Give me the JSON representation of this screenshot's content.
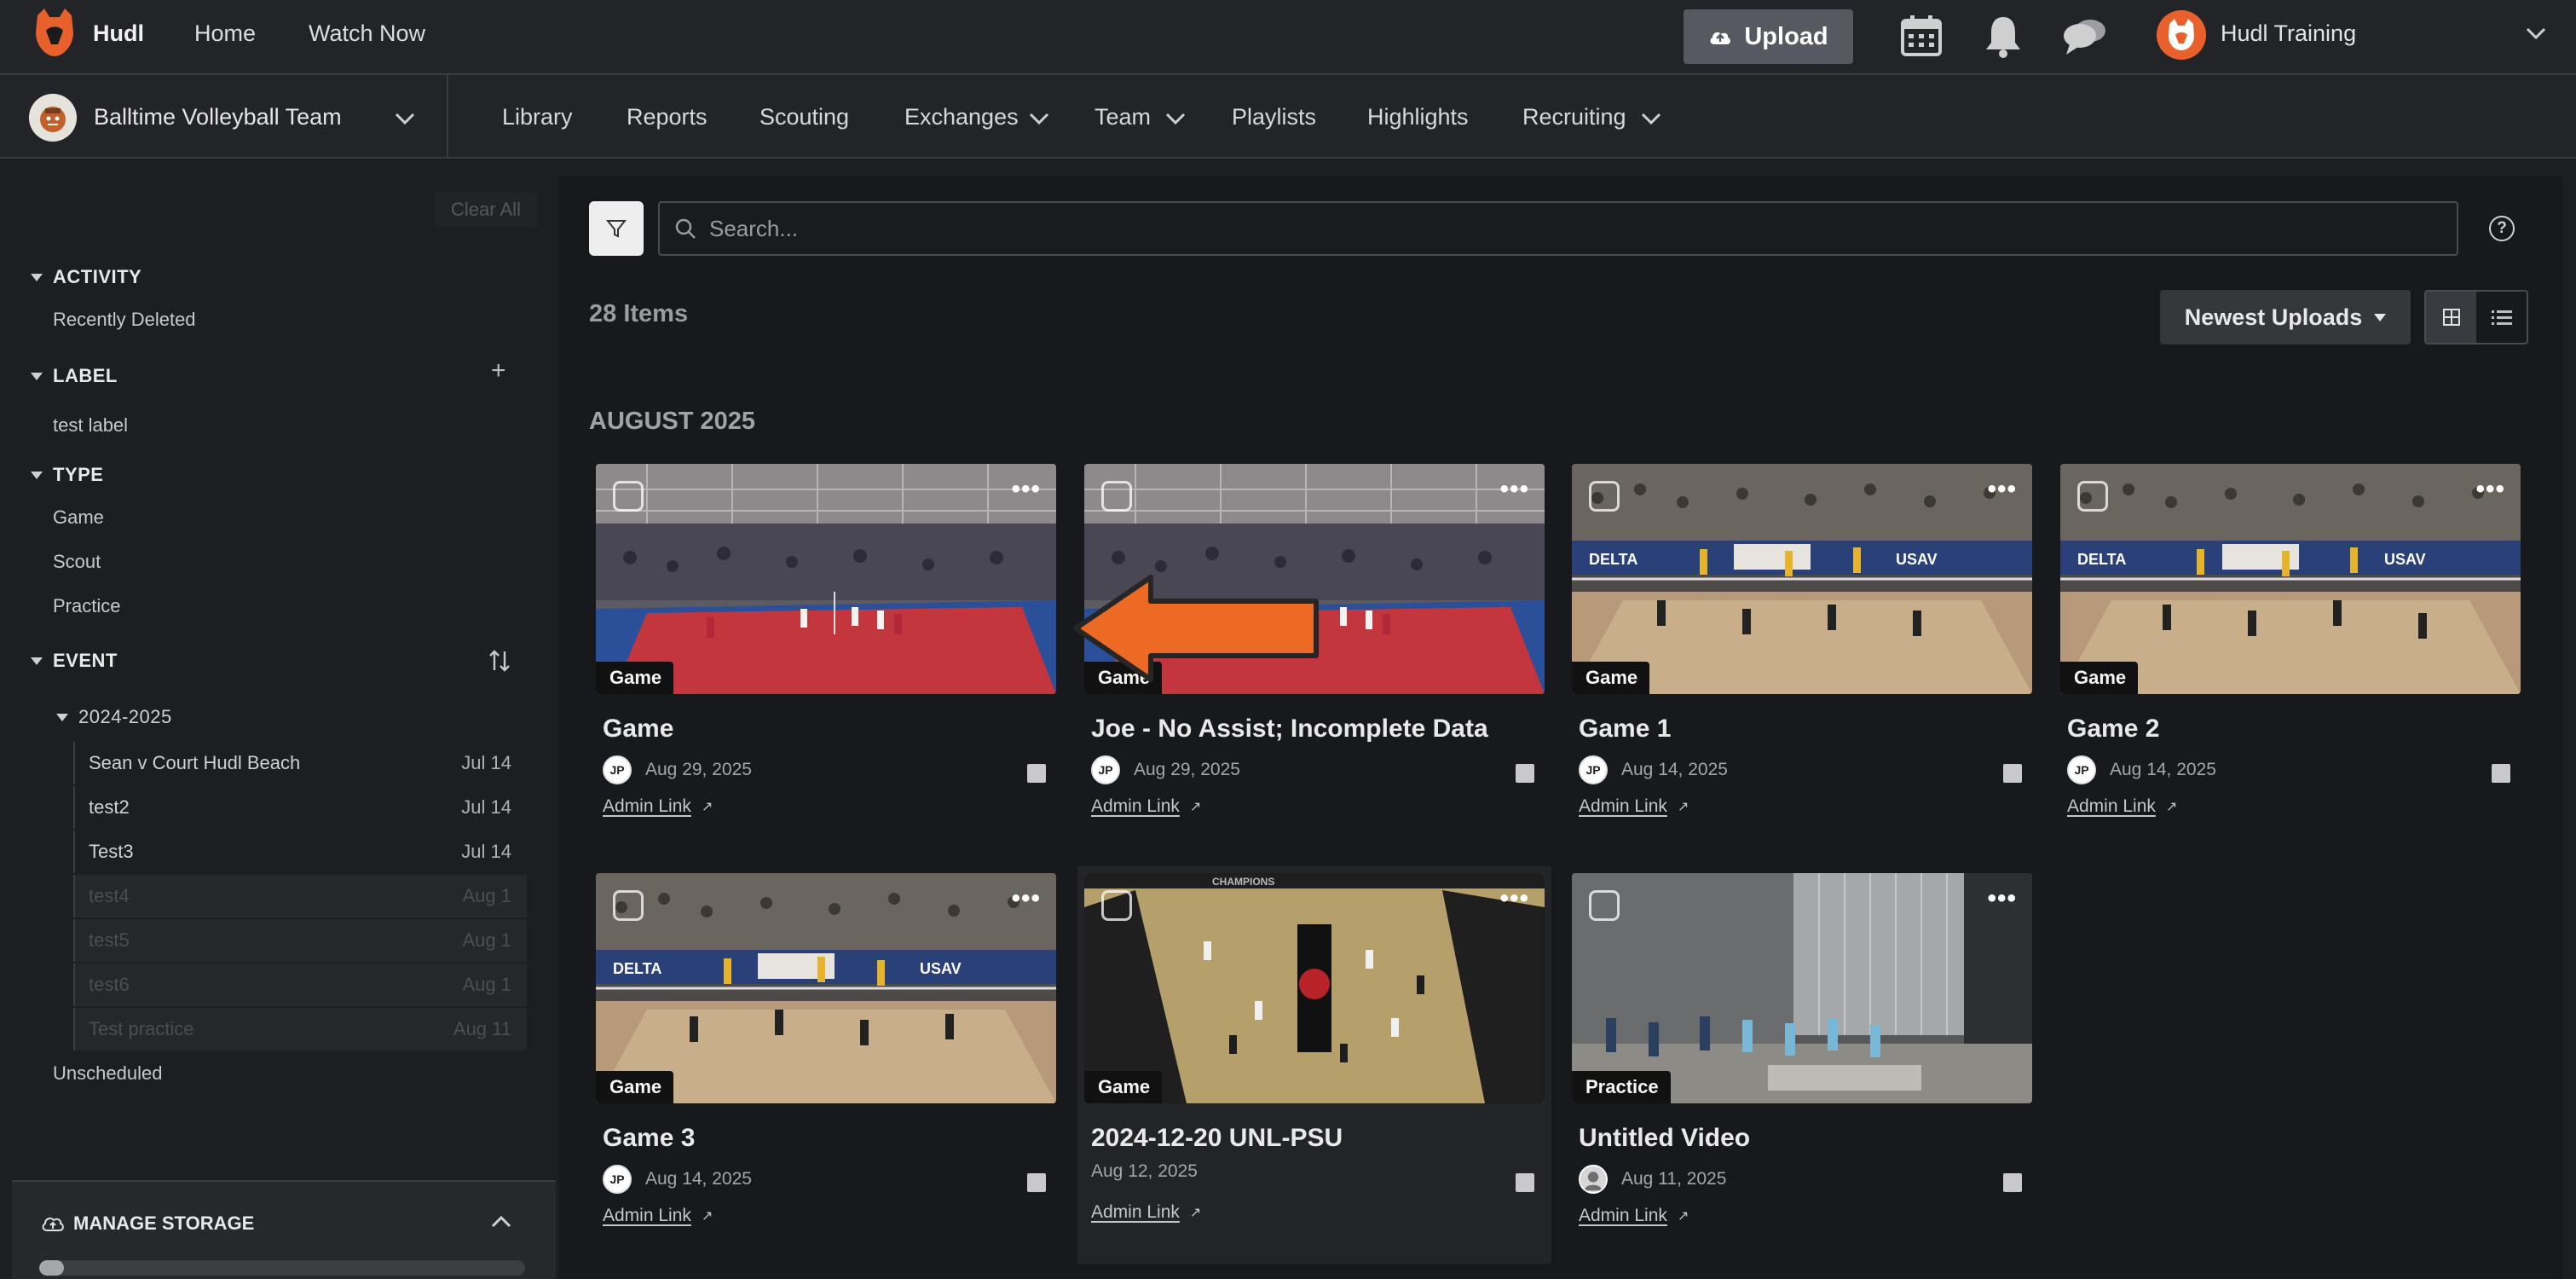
{
  "topbar": {
    "brand": "Hudl",
    "links": [
      "Home",
      "Watch Now"
    ],
    "upload_label": "Upload",
    "user_name": "Hudl Training",
    "icons": [
      "calendar-icon",
      "bell-icon",
      "chat-icon"
    ]
  },
  "subbar": {
    "team_name": "Balltime Volleyball Team",
    "links": [
      "Library",
      "Reports",
      "Scouting",
      "Exchanges",
      "Team",
      "Playlists",
      "Highlights",
      "Recruiting"
    ]
  },
  "sidebar": {
    "clear_all": "Clear All",
    "activity": {
      "title": "ACTIVITY",
      "items": [
        "Recently Deleted"
      ]
    },
    "label": {
      "title": "LABEL",
      "items": [
        "test label"
      ]
    },
    "type": {
      "title": "TYPE",
      "items": [
        "Game",
        "Scout",
        "Practice"
      ]
    },
    "event": {
      "title": "EVENT",
      "season": "2024-2025",
      "rows": [
        {
          "name": "Sean v Court Hudl Beach",
          "date": "Jul 14"
        },
        {
          "name": "test2",
          "date": "Jul 14"
        },
        {
          "name": "Test3",
          "date": "Jul 14"
        },
        {
          "name": "test4",
          "date": "Aug 1"
        },
        {
          "name": "test5",
          "date": "Aug 1"
        },
        {
          "name": "test6",
          "date": "Aug 1"
        },
        {
          "name": "Test practice",
          "date": "Aug 11"
        }
      ],
      "unscheduled": "Unscheduled"
    },
    "storage": {
      "label": "MANAGE STORAGE",
      "used_fraction": 0.05
    }
  },
  "main": {
    "search_placeholder": "Search...",
    "count": "28 Items",
    "sort_label": "Newest Uploads",
    "month": "AUGUST 2025",
    "cards": [
      {
        "title": "Game",
        "type": "Game",
        "date": "Aug 29, 2025",
        "avatar": "JP",
        "link": "Admin Link"
      },
      {
        "title": "Joe - No Assist; Incomplete Data",
        "type": "Game",
        "date": "Aug 29, 2025",
        "avatar": "JP",
        "link": "Admin Link"
      },
      {
        "title": "Game 1",
        "type": "Game",
        "date": "Aug 14, 2025",
        "avatar": "JP",
        "link": "Admin Link"
      },
      {
        "title": "Game 2",
        "type": "Game",
        "date": "Aug 14, 2025",
        "avatar": "JP",
        "link": "Admin Link"
      },
      {
        "title": "Game 3",
        "type": "Game",
        "date": "Aug 14, 2025",
        "avatar": "JP",
        "link": "Admin Link"
      },
      {
        "title": "2024-12-20 UNL-PSU",
        "type": "Game",
        "date": "Aug 12, 2025",
        "avatar": "",
        "link": "Admin Link"
      },
      {
        "title": "Untitled Video",
        "type": "Practice",
        "date": "Aug 11, 2025",
        "avatar": "photo",
        "link": "Admin Link"
      }
    ]
  },
  "colors": {
    "accent": "#e8612c",
    "arrow": "#ec6a24",
    "background": "#18191c"
  }
}
